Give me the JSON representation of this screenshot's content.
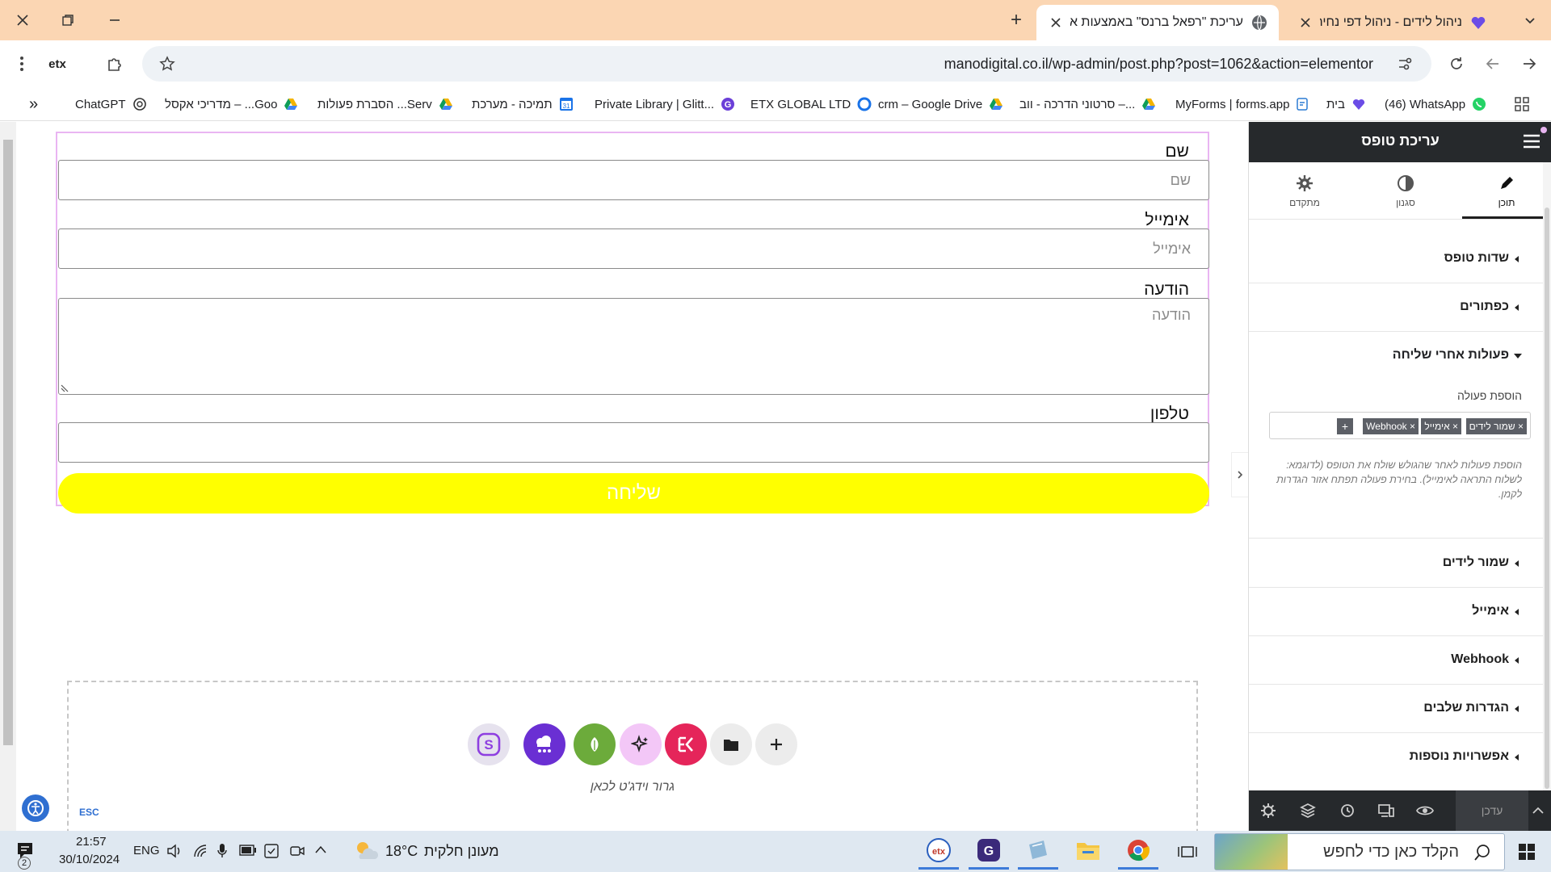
{
  "browser": {
    "tabs": [
      {
        "title": "ניהול לידים - ניהול דפי נחיתה",
        "active": false
      },
      {
        "title": "עריכת \"רפאל ברנס\" באמצעות א",
        "active": true
      }
    ],
    "new_tab": "+",
    "url": "manodigital.co.il/wp-admin/post.php?post=1062&action=elementor",
    "bookmarks": [
      {
        "label": "(46) WhatsApp",
        "icon": "whatsapp-icon"
      },
      {
        "label": "בית",
        "icon": "heart-icon"
      },
      {
        "label": "MyForms | forms.app",
        "icon": "forms-icon"
      },
      {
        "label": "סרטוני הדרכה - ווב –...",
        "icon": "drive-icon"
      },
      {
        "label": "crm – Google Drive",
        "icon": "drive-icon"
      },
      {
        "label": "ETX GLOBAL LTD",
        "icon": "circle-icon"
      },
      {
        "label": "Private Library | Glitt...",
        "icon": "g-icon"
      },
      {
        "label": "תמיכה - מערכת",
        "icon": "calendar-icon"
      },
      {
        "label": "הסברת פעולות ...Serv",
        "icon": "drive-icon"
      },
      {
        "label": "מדריכי אקסל – ...Goo",
        "icon": "drive-icon"
      },
      {
        "label": "ChatGPT",
        "icon": "openai-icon"
      }
    ],
    "bookmarks_overflow": "»"
  },
  "form": {
    "fields": [
      {
        "label": "שם",
        "placeholder": "שם"
      },
      {
        "label": "אימייל",
        "placeholder": "אימייל"
      },
      {
        "label": "הודעה",
        "placeholder": "הודעה"
      },
      {
        "label": "טלפון",
        "placeholder": ""
      }
    ],
    "submit_label": "שליחה",
    "submit_color": "#ffff00"
  },
  "dropzone": {
    "label": "גרור וידג'ט לכאן",
    "tools": [
      "add-icon",
      "folder-icon",
      "elementskit-icon",
      "ai-sparkle-icon",
      "leaf-icon",
      "cloud-icon",
      "s-logo-icon"
    ]
  },
  "esc_label": "ESC",
  "panel": {
    "title": "עריכת טופס",
    "tabs": [
      {
        "label": "תוכן",
        "icon": "pencil-icon"
      },
      {
        "label": "סגנון",
        "icon": "contrast-icon"
      },
      {
        "label": "מתקדם",
        "icon": "gear-icon"
      }
    ],
    "sections_top": [
      "שדות טופס",
      "כפתורים"
    ],
    "actions_section": {
      "title": "פעולות אחרי שליחה",
      "add_action_label": "הוספת פעולה",
      "chips": [
        "שמור לידים",
        "אימייל",
        "Webhook"
      ],
      "chip_add": "+",
      "help": "הוספת פעולות לאחר שהגולש שולח את הטופס (לדוגמא: לשלוח התראה לאימייל). בחירת פעולה תפתח אזור הגדרות לקמן."
    },
    "sections_bottom": [
      "שמור לידים",
      "אימייל",
      "Webhook",
      "הגדרות שלבים",
      "אפשרויות נוספות"
    ],
    "footer_update": "עדכן"
  },
  "taskbar": {
    "search_placeholder": "הקלד כאן כדי לחפש",
    "weather_text": "מעונן חלקית",
    "temperature": "18°C",
    "language": "ENG",
    "time": "21:57",
    "date": "30/10/2024",
    "notifications": "2"
  }
}
